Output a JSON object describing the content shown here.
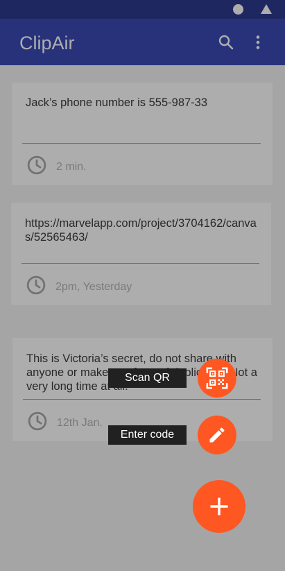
{
  "app": {
    "title": "ClipAir"
  },
  "clips": [
    {
      "text": "Jack’s phone number is 555-987-33",
      "time": "2 min."
    },
    {
      "text": "https://marvelapp.com/project/3704162/canvas/52565463/",
      "time": "2pm, Yesterday"
    },
    {
      "text": "This is Victoria’s secret, do not share with anyone or make any form of duplicates. Not a very long time at all.",
      "time": "12th Jan."
    }
  ],
  "speed_dial": {
    "scan_qr_label": "Scan QR",
    "enter_code_label": "Enter code"
  },
  "colors": {
    "primary": "#3c4bb5",
    "primary_dark": "#2f3a8f",
    "accent": "#ff5722"
  }
}
